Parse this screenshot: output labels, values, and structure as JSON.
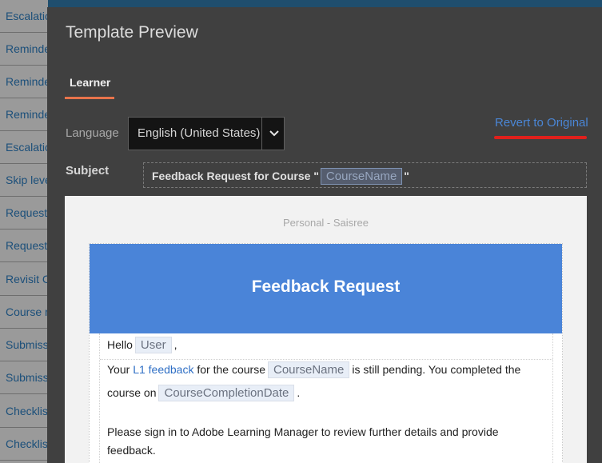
{
  "background_list": {
    "items": [
      "Escalation",
      "Reminder",
      "Reminder",
      "Reminder",
      "Escalation",
      "Skip level",
      "Request",
      "Request",
      "Revisit C",
      "Course r",
      "Submission",
      "Submission",
      "Checklist",
      "Checklist"
    ]
  },
  "modal": {
    "title": "Template Preview",
    "tabs": [
      {
        "label": "Learner"
      }
    ],
    "language_label": "Language",
    "language_value": "English (United States)",
    "revert_label": "Revert to Original",
    "subject_label": "Subject",
    "subject": {
      "prefix": "Feedback Request for Course \"",
      "token": "CourseName",
      "suffix": "\""
    }
  },
  "email": {
    "sender": "Personal - Saisree",
    "heading": "Feedback Request",
    "greeting": "Hello",
    "greeting_token": "User",
    "greeting_suffix": ",",
    "line1_prefix": "Your",
    "line1_link": "L1 feedback",
    "line1_mid": "for the course",
    "line1_token": "CourseName",
    "line1_suffix": "is still pending. You completed the",
    "line2_prefix": "course on",
    "line2_token": "CourseCompletionDate",
    "line2_suffix": ".",
    "line3": "Please sign in to Adobe Learning Manager to review further details and provide",
    "line4": "feedback."
  },
  "colors": {
    "accent_tab": "#e8734b",
    "link": "#4a86d6",
    "banner": "#4a84d8",
    "highlight": "#e0201c"
  },
  "icons": {
    "dropdown": "chevron-down-icon"
  }
}
